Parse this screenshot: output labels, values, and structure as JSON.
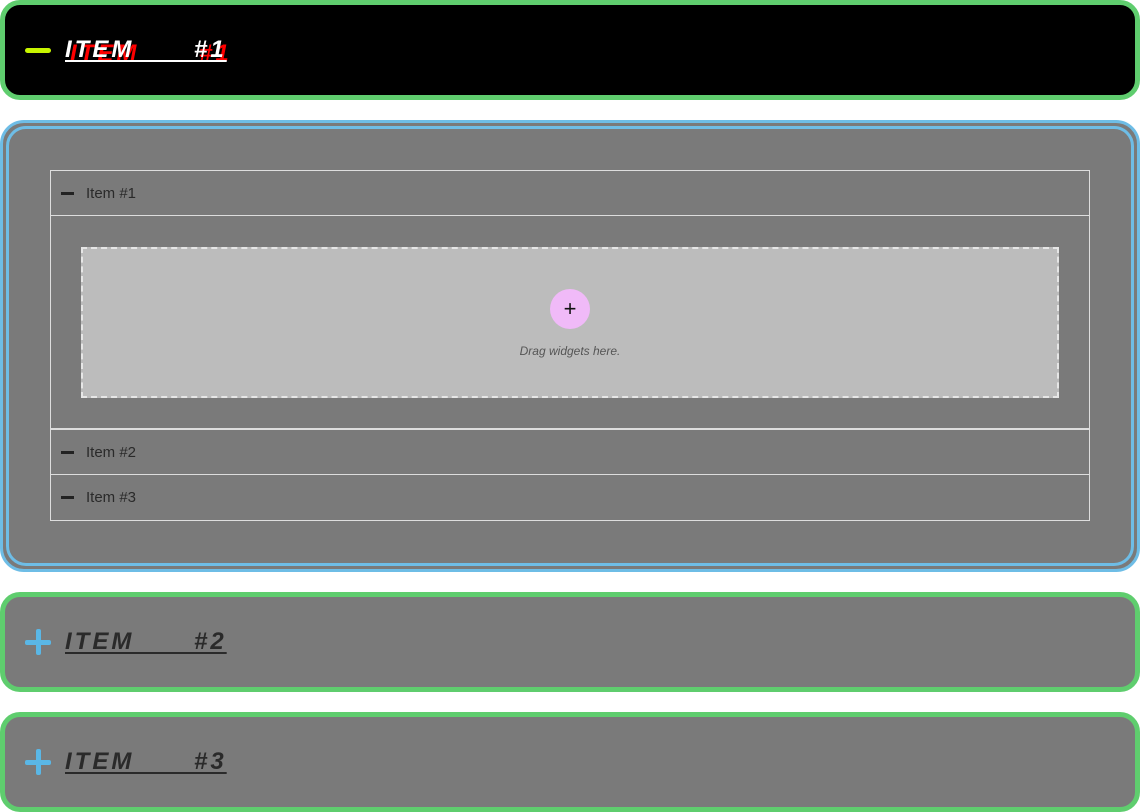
{
  "sections": [
    {
      "title": "ITEM #1",
      "expanded": true
    },
    {
      "title": "ITEM #2",
      "expanded": false
    },
    {
      "title": "ITEM #3",
      "expanded": false
    }
  ],
  "nested": {
    "items": [
      {
        "label": "Item #1"
      },
      {
        "label": "Item #2"
      },
      {
        "label": "Item #3"
      }
    ],
    "dropzone": {
      "add_label": "+",
      "hint": "Drag widgets here."
    }
  },
  "colors": {
    "border_green": "#5fcd6e",
    "border_blue": "#6ebde6",
    "minus_icon": "#c8f500",
    "plus_icon": "#5ab7e6",
    "add_button": "#f0baf8",
    "shadow_text": "#ff0000"
  }
}
